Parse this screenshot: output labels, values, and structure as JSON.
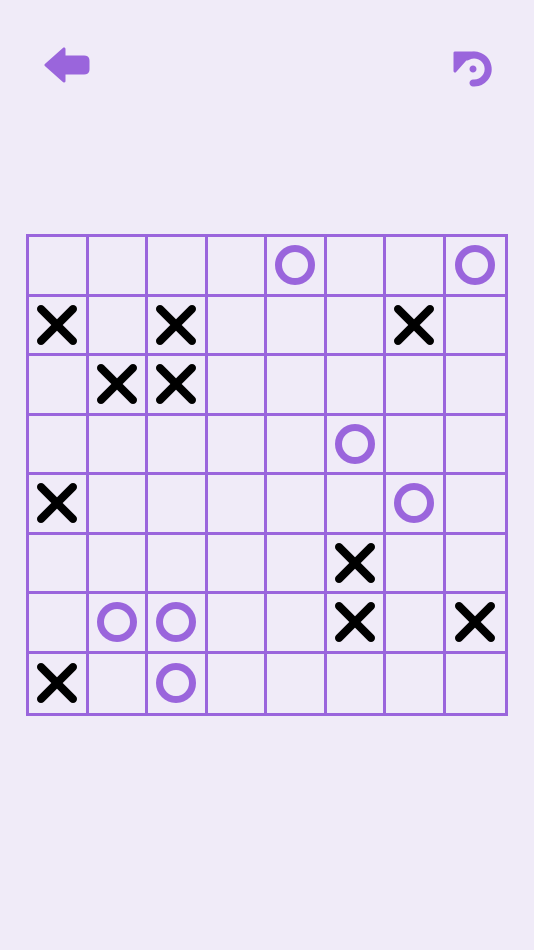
{
  "icons": {
    "back": "back-arrow-icon",
    "undo": "undo-icon"
  },
  "colors": {
    "background": "#f0ebf8",
    "grid": "#9a65dc",
    "x_mark": "#000000",
    "o_mark": "#9a65dc"
  },
  "board": {
    "size": 8,
    "rows": [
      [
        "",
        "",
        "",
        "",
        "O",
        "",
        "",
        "O"
      ],
      [
        "X",
        "",
        "X",
        "",
        "",
        "",
        "X",
        ""
      ],
      [
        "",
        "X",
        "X",
        "",
        "",
        "",
        "",
        ""
      ],
      [
        "",
        "",
        "",
        "",
        "",
        "O",
        "",
        ""
      ],
      [
        "X",
        "",
        "",
        "",
        "",
        "",
        "O",
        ""
      ],
      [
        "",
        "",
        "",
        "",
        "",
        "X",
        "",
        ""
      ],
      [
        "",
        "O",
        "O",
        "",
        "",
        "X",
        "",
        "X"
      ],
      [
        "X",
        "",
        "O",
        "",
        "",
        "",
        "",
        ""
      ]
    ]
  }
}
